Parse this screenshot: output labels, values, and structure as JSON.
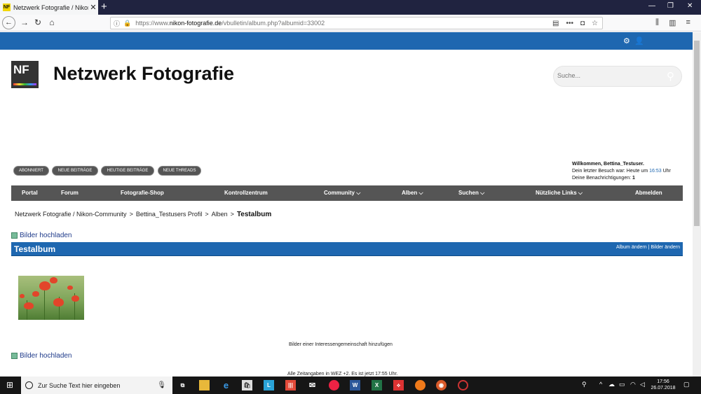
{
  "browser": {
    "tab_title": "Netzwerk Fotografie / Nikon-C",
    "tab_favicon": "NF",
    "url_prefix": "https://www.",
    "url_domain": "nikon-fotografie.de",
    "url_path": "/vbulletin/album.php?albumid=33002"
  },
  "header": {
    "logo_text": "NF",
    "site_title": "Netzwerk Fotografie",
    "search_placeholder": "Suche..."
  },
  "pills": [
    "ABONNIERT",
    "NEUE BEITRÄGE",
    "HEUTIGE BEITRÄGE",
    "NEUE THREADS"
  ],
  "welcome": {
    "line1": "Willkommen, Bettina_Testuser.",
    "line2_prefix": "Dein letzter Besuch war: Heute um ",
    "line2_time": "16:53",
    "line2_suffix": " Uhr",
    "line3_prefix": "Deine Benachrichtigungen: ",
    "line3_count": "1"
  },
  "menu": [
    "Portal",
    "Forum",
    "Fotografie-Shop",
    "Kontrollzentrum",
    "Community",
    "Alben",
    "Suchen",
    "Nützliche Links",
    "Abmelden"
  ],
  "breadcrumb": {
    "items": [
      "Netzwerk Fotografie / Nikon-Community",
      "Bettina_Testusers Profil",
      "Alben"
    ],
    "separator": ">",
    "current": "Testalbum"
  },
  "album": {
    "upload_label": "Bilder hochladen",
    "title": "Testalbum",
    "action_edit_album": "Album ändern",
    "action_sep": "|",
    "action_edit_images": "Bilder ändern",
    "interest_link": "Bilder einer Interessengemeinschaft hinzufügen",
    "footer": "Alle Zeitangaben in WEZ +2. Es ist jetzt 17:55 Uhr."
  },
  "taskbar": {
    "search_placeholder": "Zur Suche Text hier eingeben",
    "time": "17:56",
    "date": "26.07.2018"
  },
  "colors": {
    "brand_blue": "#1e67b0",
    "menu_gray": "#555555"
  }
}
